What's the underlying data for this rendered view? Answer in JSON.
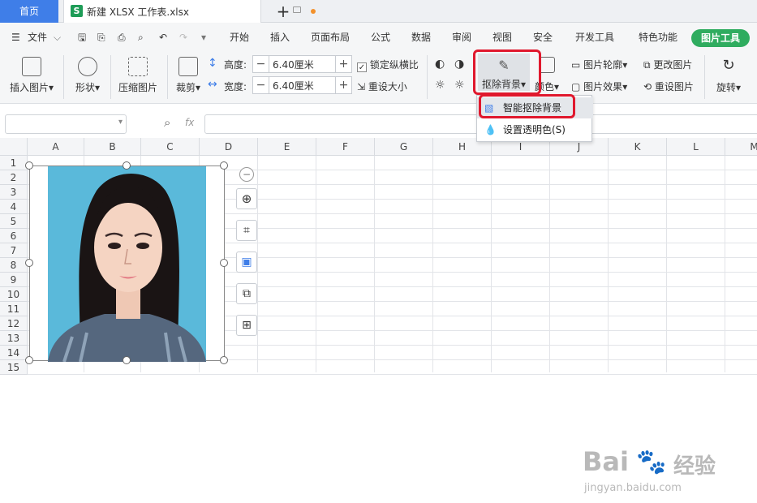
{
  "tabs": {
    "home": "首页",
    "file_name": "新建 XLSX 工作表.xlsx",
    "file_icon": "S",
    "accent_home": "#3f7ee8",
    "accent_file": "#1e9c57"
  },
  "menu": {
    "file": "文件",
    "items": [
      "开始",
      "插入",
      "页面布局",
      "公式",
      "数据",
      "审阅",
      "视图",
      "安全",
      "开发工具",
      "特色功能"
    ],
    "active": "图片工具",
    "active_color": "#2fac5f"
  },
  "ribbon": {
    "insert_picture": "插入图片",
    "shape": "形状",
    "compress": "压缩图片",
    "crop": "裁剪",
    "height_label": "高度:",
    "height_value": "6.40厘米",
    "width_label": "宽度:",
    "width_value": "6.40厘米",
    "lock_ratio": "锁定纵横比",
    "reset_size": "重设大小",
    "remove_bg": "抠除背景",
    "color": "颜色",
    "outline": "图片轮廓",
    "change_pic": "更改图片",
    "effects": "图片效果",
    "reset_pic": "重设图片",
    "rotate": "旋转"
  },
  "dropdown": {
    "smart_remove": "智能抠除背景",
    "set_transparent": "设置透明色(S)"
  },
  "grid": {
    "columns": [
      "A",
      "B",
      "C",
      "D",
      "E",
      "F",
      "G",
      "H",
      "I",
      "J",
      "K",
      "L",
      "M"
    ],
    "rows": [
      "1",
      "2",
      "3",
      "4",
      "5",
      "6",
      "7",
      "8",
      "9",
      "10",
      "11",
      "12",
      "13",
      "14",
      "15"
    ]
  },
  "formula": {
    "fx": "fx"
  },
  "watermark": {
    "brand": "Bai",
    "brand_cn": "经验",
    "url": "jingyan.baidu.com"
  },
  "colors": {
    "highlight": "#e0182d",
    "photo_bg": "#5ab9da"
  }
}
